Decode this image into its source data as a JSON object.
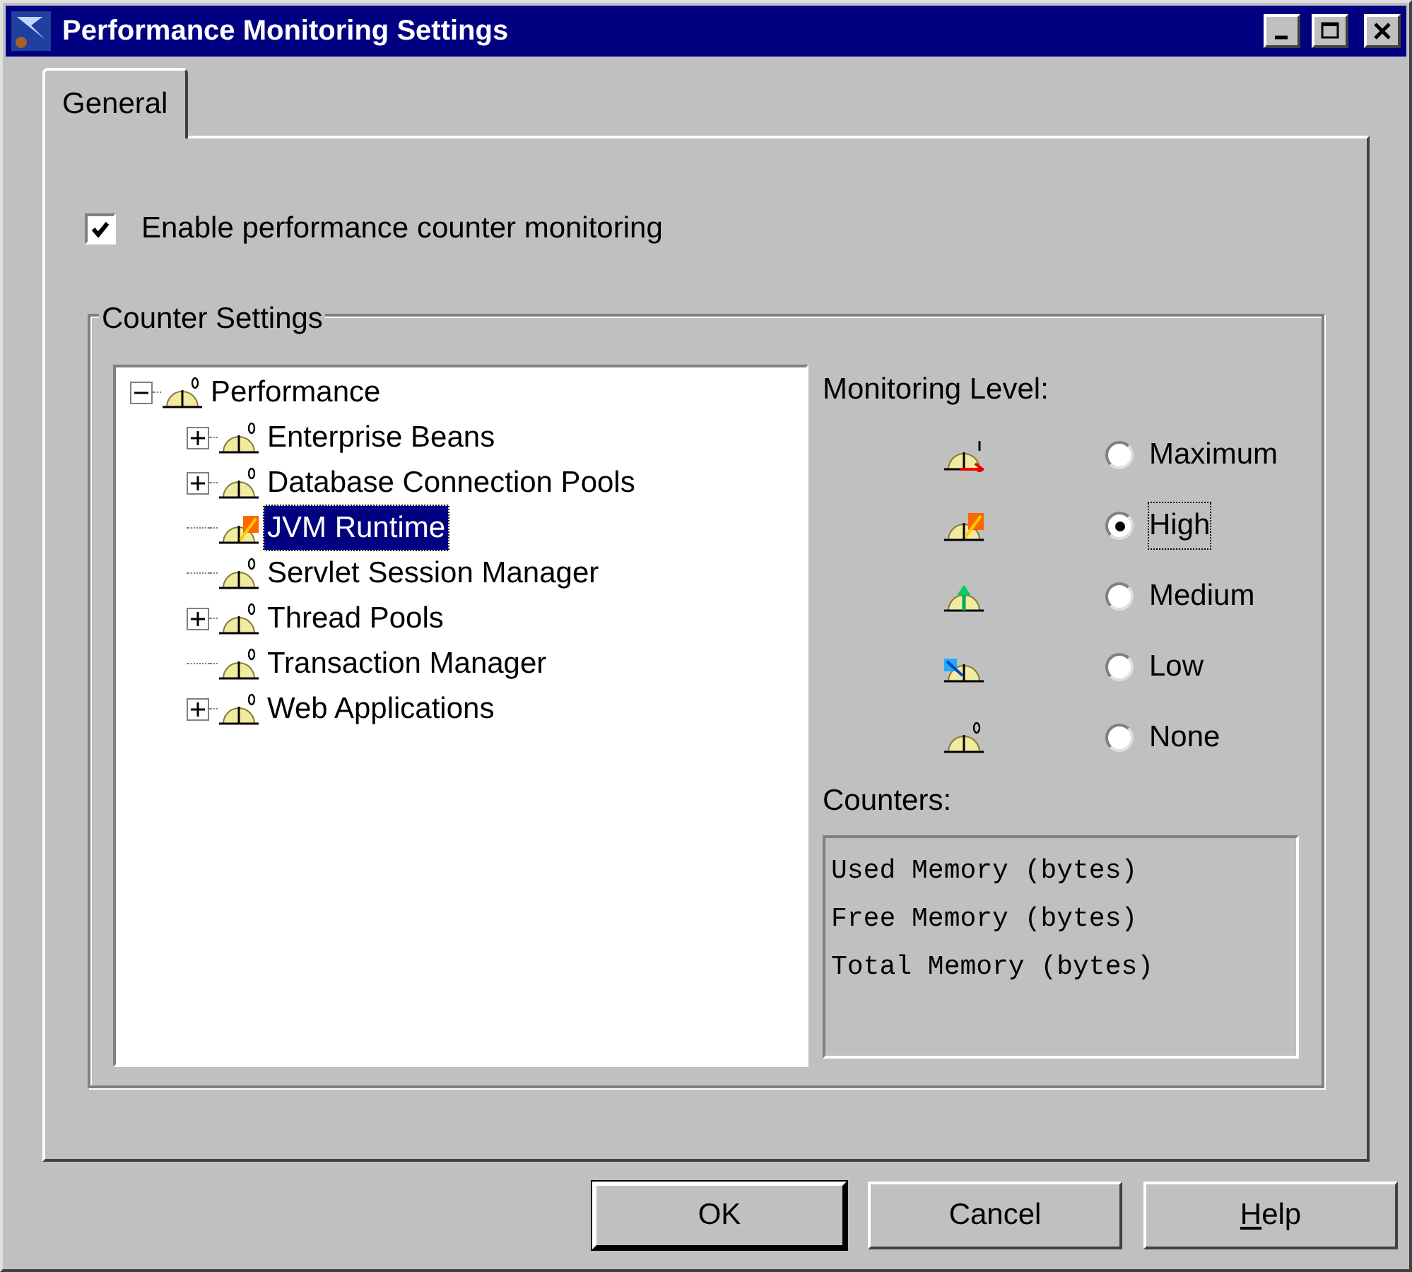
{
  "window": {
    "title": "Performance Monitoring Settings"
  },
  "tabs": [
    {
      "label": "General",
      "selected": true
    }
  ],
  "enable_checkbox": {
    "label": "Enable performance counter monitoring",
    "checked": true
  },
  "counter_settings": {
    "title": "Counter Settings",
    "tree": [
      {
        "label": "Performance",
        "kind": "none",
        "expanded": true,
        "selected": false,
        "children": [
          {
            "label": "Enterprise Beans",
            "kind": "none",
            "expanded": false,
            "selected": false
          },
          {
            "label": "Database Connection Pools",
            "kind": "none",
            "expanded": false,
            "selected": false
          },
          {
            "label": "JVM Runtime",
            "kind": "high",
            "selected": true
          },
          {
            "label": "Servlet Session Manager",
            "kind": "none",
            "selected": false
          },
          {
            "label": "Thread Pools",
            "kind": "none",
            "expanded": false,
            "selected": false
          },
          {
            "label": "Transaction Manager",
            "kind": "none",
            "selected": false
          },
          {
            "label": "Web Applications",
            "kind": "none",
            "expanded": false,
            "selected": false
          }
        ]
      }
    ],
    "monitoring_level": {
      "label": "Monitoring Level:",
      "options": [
        {
          "label": "Maximum",
          "kind": "maximum",
          "selected": false,
          "focused": false
        },
        {
          "label": "High",
          "kind": "high",
          "selected": true,
          "focused": true
        },
        {
          "label": "Medium",
          "kind": "medium",
          "selected": false,
          "focused": false
        },
        {
          "label": "Low",
          "kind": "low",
          "selected": false,
          "focused": false
        },
        {
          "label": "None",
          "kind": "none",
          "selected": false,
          "focused": false
        }
      ]
    },
    "counters": {
      "label": "Counters:",
      "items": [
        "Used Memory (bytes)",
        "Free Memory (bytes)",
        "Total Memory (bytes)"
      ]
    }
  },
  "buttons": [
    {
      "label": "OK",
      "default": true,
      "mnemonic": false
    },
    {
      "label": "Cancel",
      "default": false,
      "mnemonic": false
    },
    {
      "label": "Help",
      "default": false,
      "mnemonic": true
    }
  ]
}
